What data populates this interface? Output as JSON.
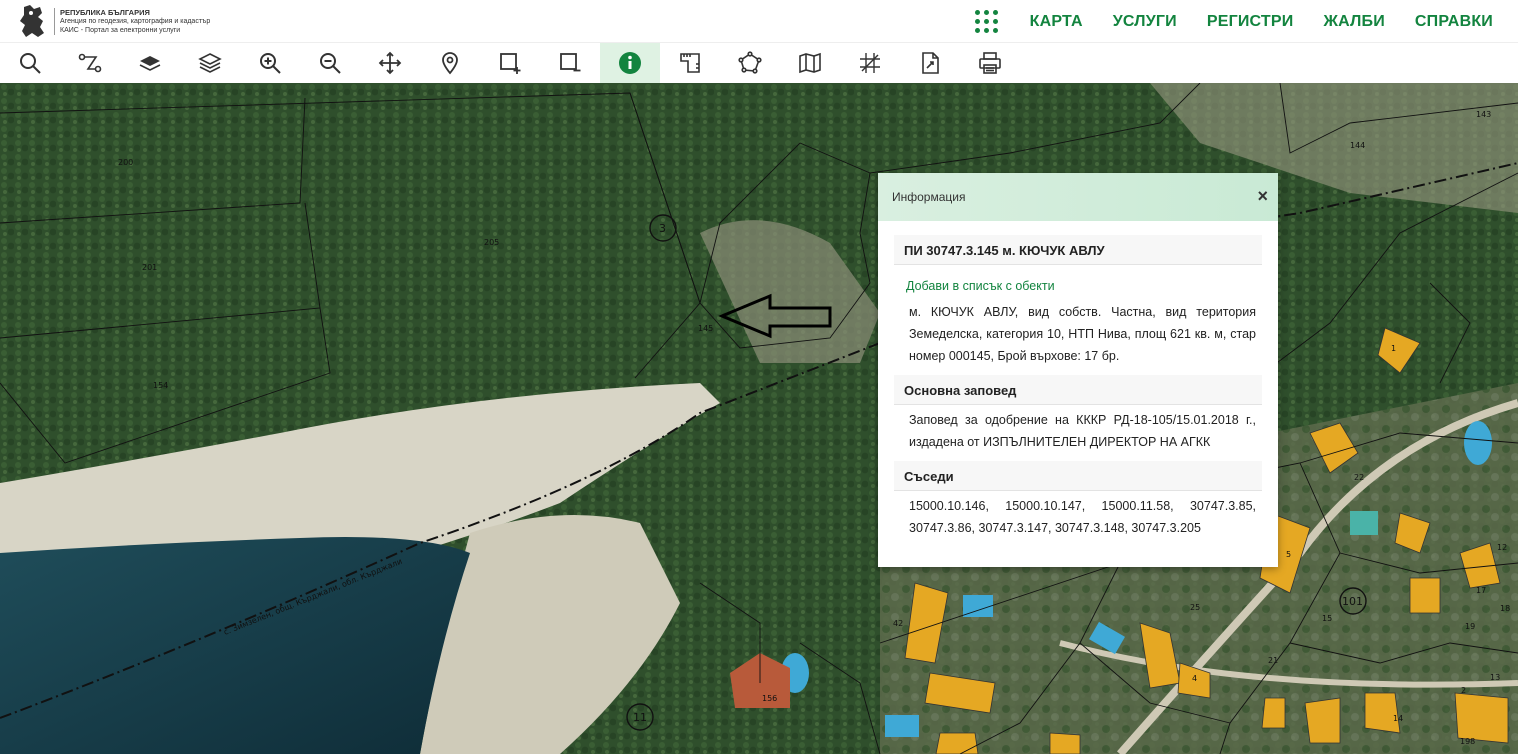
{
  "header": {
    "logo": {
      "line1": "РЕПУБЛИКА БЪЛГАРИЯ",
      "line2": "Агенция по геодезия, картография и кадастър",
      "line3": "КАИС - Портал за електронни услуги"
    },
    "nav": [
      {
        "label": "КАРТА"
      },
      {
        "label": "УСЛУГИ"
      },
      {
        "label": "РЕГИСТРИ"
      },
      {
        "label": "ЖАЛБИ"
      },
      {
        "label": "СПРАВКИ"
      }
    ],
    "accent_color": "#13843f"
  },
  "toolbar": {
    "tools": [
      {
        "icon": "search-icon"
      },
      {
        "icon": "route-icon"
      },
      {
        "icon": "layer-icon"
      },
      {
        "icon": "layers-icon"
      },
      {
        "icon": "zoom-in-icon"
      },
      {
        "icon": "zoom-out-icon"
      },
      {
        "icon": "pan-icon"
      },
      {
        "icon": "location-pin-icon"
      },
      {
        "icon": "select-add-icon"
      },
      {
        "icon": "select-remove-icon"
      },
      {
        "icon": "info-icon",
        "active": true
      },
      {
        "icon": "measure-icon"
      },
      {
        "icon": "polygon-icon"
      },
      {
        "icon": "map-icon"
      },
      {
        "icon": "crosshair-grid-icon"
      },
      {
        "icon": "export-icon"
      },
      {
        "icon": "print-icon"
      }
    ]
  },
  "map": {
    "parcel_labels": [
      "200",
      "201",
      "205",
      "154",
      "145",
      "144",
      "143",
      "3",
      "11",
      "101",
      "156",
      "12",
      "22",
      "25",
      "26",
      "21",
      "19",
      "18",
      "17",
      "15",
      "13",
      "14",
      "198",
      "5",
      "1",
      "2",
      "4",
      "42"
    ],
    "road_label": "с. Зимзелен, общ. Кърджали, обл. Кърджали"
  },
  "popup": {
    "title": "Информация",
    "close": "×",
    "parcel_title": "ПИ 30747.3.145 м. КЮЧУК АВЛУ",
    "add_link": "Добави в списък с обекти",
    "description": "м. КЮЧУК АВЛУ, вид собств. Частна, вид територия Земеделска, категория 10, НТП Нива, площ 621 кв. м, стар номер 000145, Брой върхове: 17 бр.",
    "order_title": "Основна заповед",
    "order_text": "Заповед за одобрение на КККР РД-18-105/15.01.2018 г., издадена от ИЗПЪЛНИТЕЛЕН ДИРЕКТОР НА АГКК",
    "neighbors_title": "Съседи",
    "neighbors_text": "15000.10.146, 15000.10.147, 15000.11.58, 30747.3.85, 30747.3.86, 30747.3.147, 30747.3.148, 30747.3.205"
  }
}
